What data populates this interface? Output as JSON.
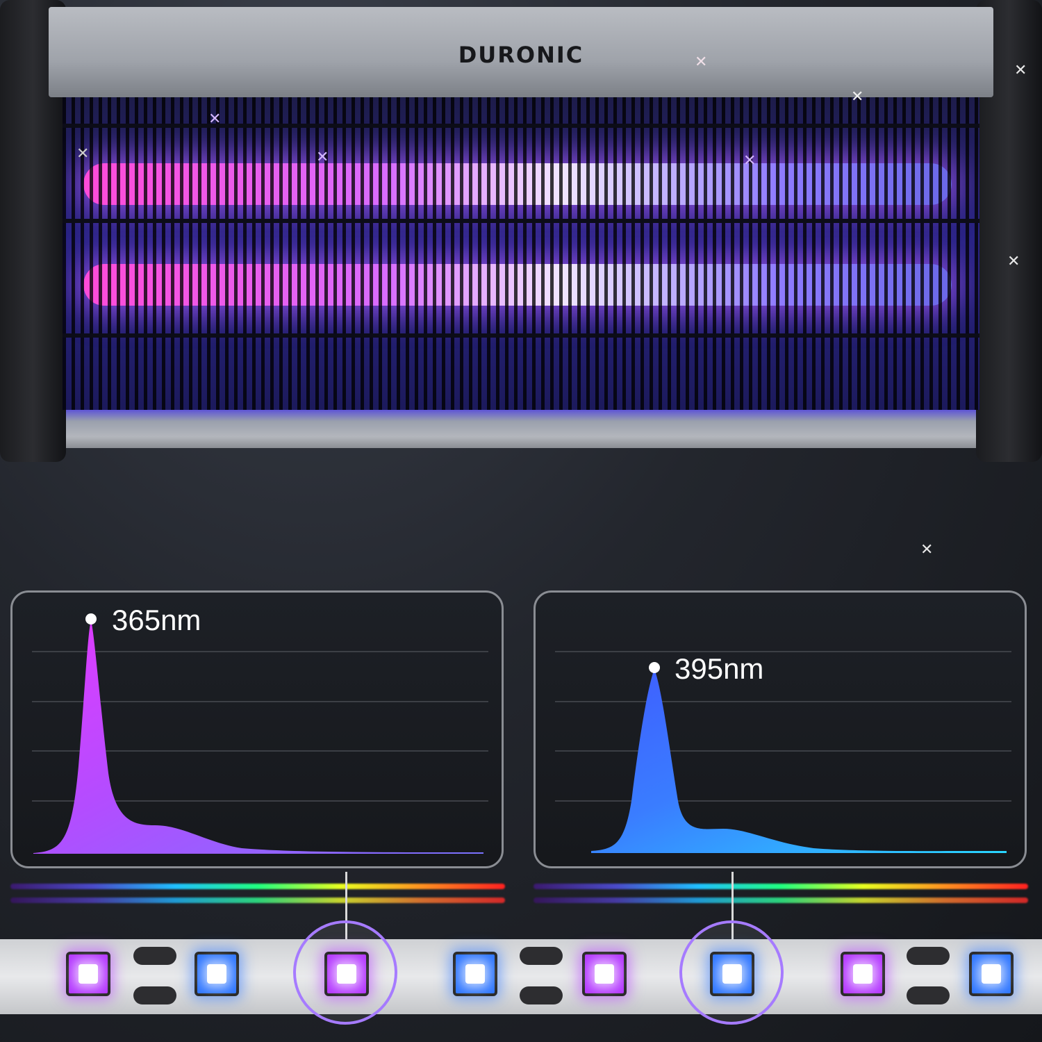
{
  "product": {
    "brand": "DURONIC"
  },
  "spectra": [
    {
      "peak_label": "365nm",
      "color_top": "#e23bff",
      "color_mid": "#b44cff",
      "color_tail": "#7a73ff"
    },
    {
      "peak_label": "395nm",
      "color_top": "#3f5cff",
      "color_mid": "#3a7dff",
      "color_tail": "#29d6ff"
    }
  ],
  "led_strip": {
    "pattern": [
      "purple",
      "blue",
      "purple",
      "blue",
      "purple",
      "blue",
      "purple",
      "blue"
    ],
    "highlighted": [
      "purple",
      "blue"
    ]
  },
  "colors": {
    "uv_purple": "#b438ff",
    "uv_blue": "#2f76ff",
    "panel_border": "#8a8d93"
  }
}
